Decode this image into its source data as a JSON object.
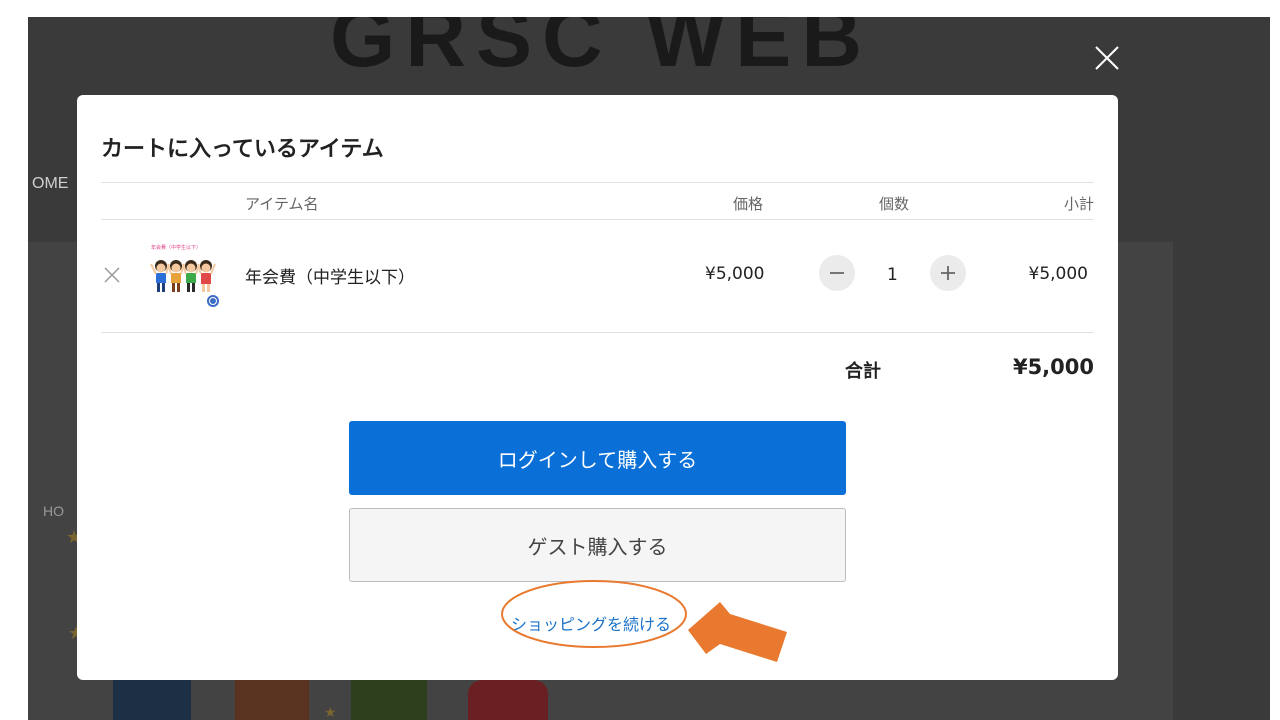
{
  "background": {
    "logo_text": "GRSC WEB",
    "nav_home": "OME",
    "breadcrumb": "HO"
  },
  "overlay": {
    "close_icon": "close-icon"
  },
  "cart_modal": {
    "title": "カートに入っているアイテム",
    "columns": {
      "name": "アイテム名",
      "price": "価格",
      "quantity": "個数",
      "subtotal": "小計"
    },
    "items": [
      {
        "name": "年会費（中学生以下）",
        "price": "¥5,000",
        "quantity": "1",
        "subtotal": "¥5,000",
        "thumbnail_caption": "年会費（中学生以下）",
        "thumbnail_icon": "children-illustration"
      }
    ],
    "total_label": "合計",
    "total_value": "¥5,000",
    "login_button": "ログインして購入する",
    "guest_button": "ゲスト購入する",
    "continue_link": "ショッピングを続ける"
  },
  "colors": {
    "primary_button": "#0a70d8",
    "link": "#1a73c8",
    "annotation": "#e8792f"
  }
}
